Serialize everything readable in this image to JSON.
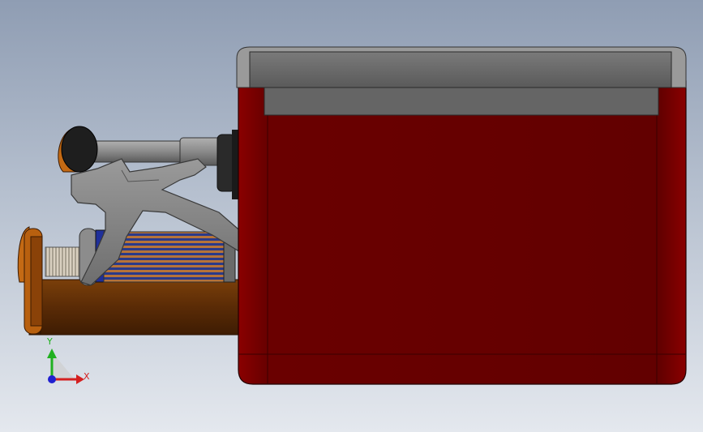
{
  "viewport": {
    "background_top": "#8f9db3",
    "background_bottom": "#e4e8ee"
  },
  "model": {
    "housing_color": "#6a0000",
    "lid_color": "#5e5e5e",
    "cylinder_color": "#5a2b06",
    "filter_pleat_color": "#2a3a8a",
    "fork_color": "#8a8a8a"
  },
  "triad": {
    "x_label": "X",
    "y_label": "Y",
    "x_color": "#d42020",
    "y_color": "#20b020",
    "z_color": "#2020d0"
  }
}
